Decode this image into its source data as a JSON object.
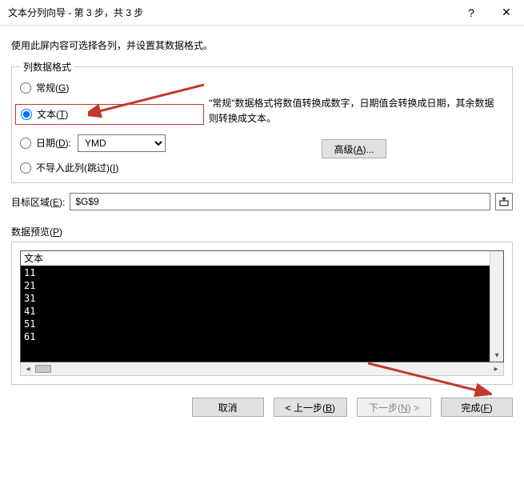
{
  "window": {
    "title": "文本分列向导 - 第 3 步，共 3 步"
  },
  "instruction": "使用此屏内容可选择各列，并设置其数据格式。",
  "group": {
    "legend": "列数据格式",
    "radios": {
      "general": "常规(G)",
      "text": "文本(T)",
      "date": "日期(D):",
      "skip": "不导入此列(跳过)(I)"
    },
    "date_format": "YMD",
    "description": "\"常规\"数据格式将数值转换成数字，日期值会转换成日期，其余数据则转换成文本。",
    "advanced": "高级(A)..."
  },
  "target": {
    "label": "目标区域(E):",
    "value": "$G$9"
  },
  "preview": {
    "legend": "数据预览(P)",
    "header": "文本",
    "rows": [
      "11",
      "21",
      "31",
      "41",
      "51",
      "61"
    ]
  },
  "buttons": {
    "cancel": "取消",
    "back": "< 上一步(B)",
    "next": "下一步(N) >",
    "finish": "完成(F)"
  }
}
